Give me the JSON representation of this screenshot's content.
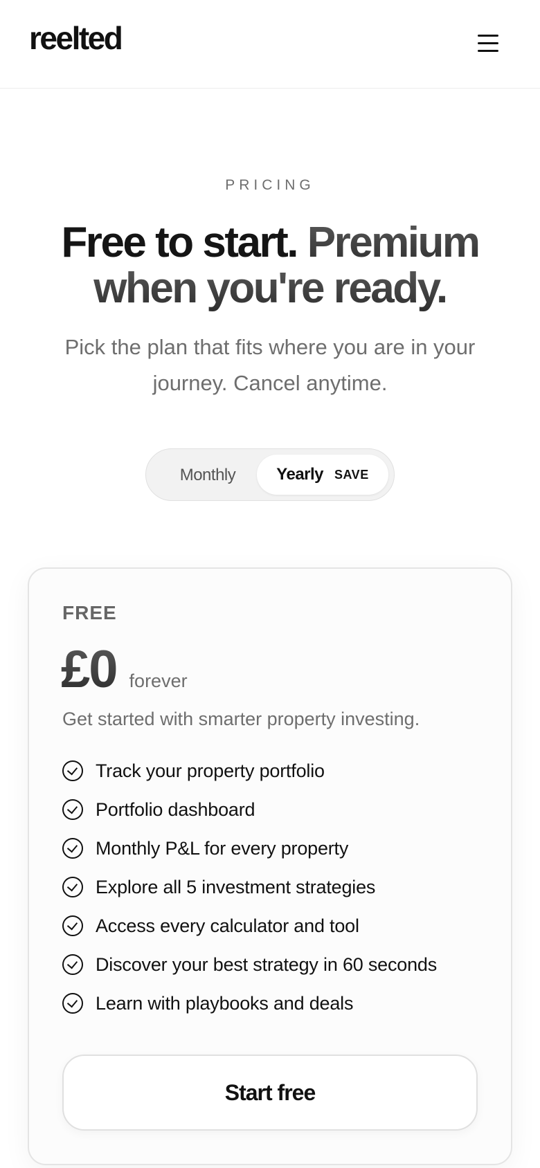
{
  "header": {
    "logo": "reelted",
    "menu_icon": "hamburger-menu-icon"
  },
  "hero": {
    "eyebrow": "PRICING",
    "headline_part1": "Free to start.",
    "headline_part2": "Premium when you're ready.",
    "subtitle": "Pick the plan that fits where you are in your journey. Cancel anytime."
  },
  "billing_toggle": {
    "monthly_label": "Monthly",
    "yearly_label": "Yearly",
    "yearly_badge": "SAVE",
    "selected": "Yearly"
  },
  "plan": {
    "name": "FREE",
    "price": "£0",
    "period": "forever",
    "description": "Get started with smarter property investing.",
    "features": [
      "Track your property portfolio",
      "Portfolio dashboard",
      "Monthly P&L for every property",
      "Explore all 5 investment strategies",
      "Access every calculator and tool",
      "Discover your best strategy in 60 seconds",
      "Learn with playbooks and deals"
    ],
    "feature_icon": "check-circle-icon",
    "cta_label": "Start free"
  }
}
